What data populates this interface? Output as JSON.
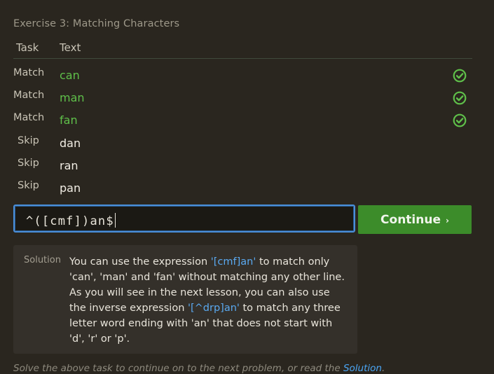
{
  "exercise": {
    "title": "Exercise 3: Matching Characters"
  },
  "table": {
    "headers": {
      "task": "Task",
      "text": "Text"
    },
    "rows": [
      {
        "task": "Match",
        "text": "can",
        "status": "matched"
      },
      {
        "task": "Match",
        "text": "man",
        "status": "matched"
      },
      {
        "task": "Match",
        "text": "fan",
        "status": "matched"
      },
      {
        "task": "Skip",
        "text": "dan",
        "status": "none"
      },
      {
        "task": "Skip",
        "text": "ran",
        "status": "none"
      },
      {
        "task": "Skip",
        "text": "pan",
        "status": "none"
      }
    ]
  },
  "regex_input": {
    "value": "^([cmf])an$"
  },
  "continue_button": {
    "label": "Continue",
    "chevron": "›"
  },
  "solution": {
    "label": "Solution",
    "p1": "You can use the expression ",
    "code1": "'[cmf]an'",
    "p2": " to match only 'can', 'man' and 'fan' without matching any other line. As you will see in the next lesson, you can also use the inverse expression ",
    "code2": "'[^drp]an'",
    "p3": " to match any three letter word ending with 'an' that does not start with 'd', 'r' or 'p'."
  },
  "footer": {
    "text": "Solve the above task to continue on to the next problem, or read the ",
    "link": "Solution",
    "end": "."
  },
  "colors": {
    "background": "#2a261f",
    "match_green": "#5fc04a",
    "button_green": "#3c8c2a",
    "input_focus": "#4a8ed8",
    "code_blue": "#5aa9f0"
  }
}
